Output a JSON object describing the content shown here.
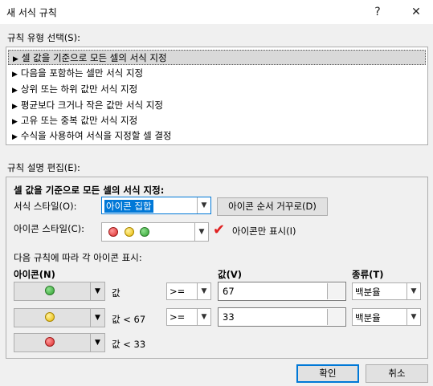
{
  "dialog": {
    "title": "새 서식 규칙",
    "help": "?",
    "close": "✕"
  },
  "rule_types": {
    "label": "규칙 유형 선택(S):",
    "items": [
      "셀 값을 기준으로 모든 셀의 서식 지정",
      "다음을 포함하는 셀만 서식 지정",
      "상위 또는 하위 값만 서식 지정",
      "평균보다 크거나 작은 값만 서식 지정",
      "고유 또는 중복 값만 서식 지정",
      "수식을 사용하여 서식을 지정할 셀 결정"
    ],
    "selected_index": 0
  },
  "rule_desc": {
    "label": "규칙 설명 편집(E):",
    "heading": "셀 값을 기준으로 모든 셀의 서식 지정:",
    "format_style_label": "서식 스타일(O):",
    "format_style_value": "아이콘 집합",
    "reverse_button": "아이콘 순서 거꾸로(D)",
    "icon_style_label": "아이콘 스타일(C):",
    "icon_only_label": "아이콘만 표시(I)",
    "icon_only_checked": true,
    "rules_caption": "다음 규칙에 따라 각 아이콘 표시:",
    "col_icon": "아이콘(N)",
    "col_value": "값(V)",
    "col_type": "종류(T)",
    "rows": [
      {
        "icon": "green-circle",
        "cond": "값",
        "op": ">=",
        "value": "67",
        "type": "백분율"
      },
      {
        "icon": "yellow-circle",
        "cond": "값 < 67",
        "op": ">=",
        "value": "33",
        "type": "백분율"
      },
      {
        "icon": "red-circle",
        "cond": "값 < 33"
      }
    ]
  },
  "footer": {
    "ok": "확인",
    "cancel": "취소"
  },
  "colors": {
    "accent": "#0078d7",
    "selection": "#d9d9d9",
    "check": "#e02020"
  }
}
